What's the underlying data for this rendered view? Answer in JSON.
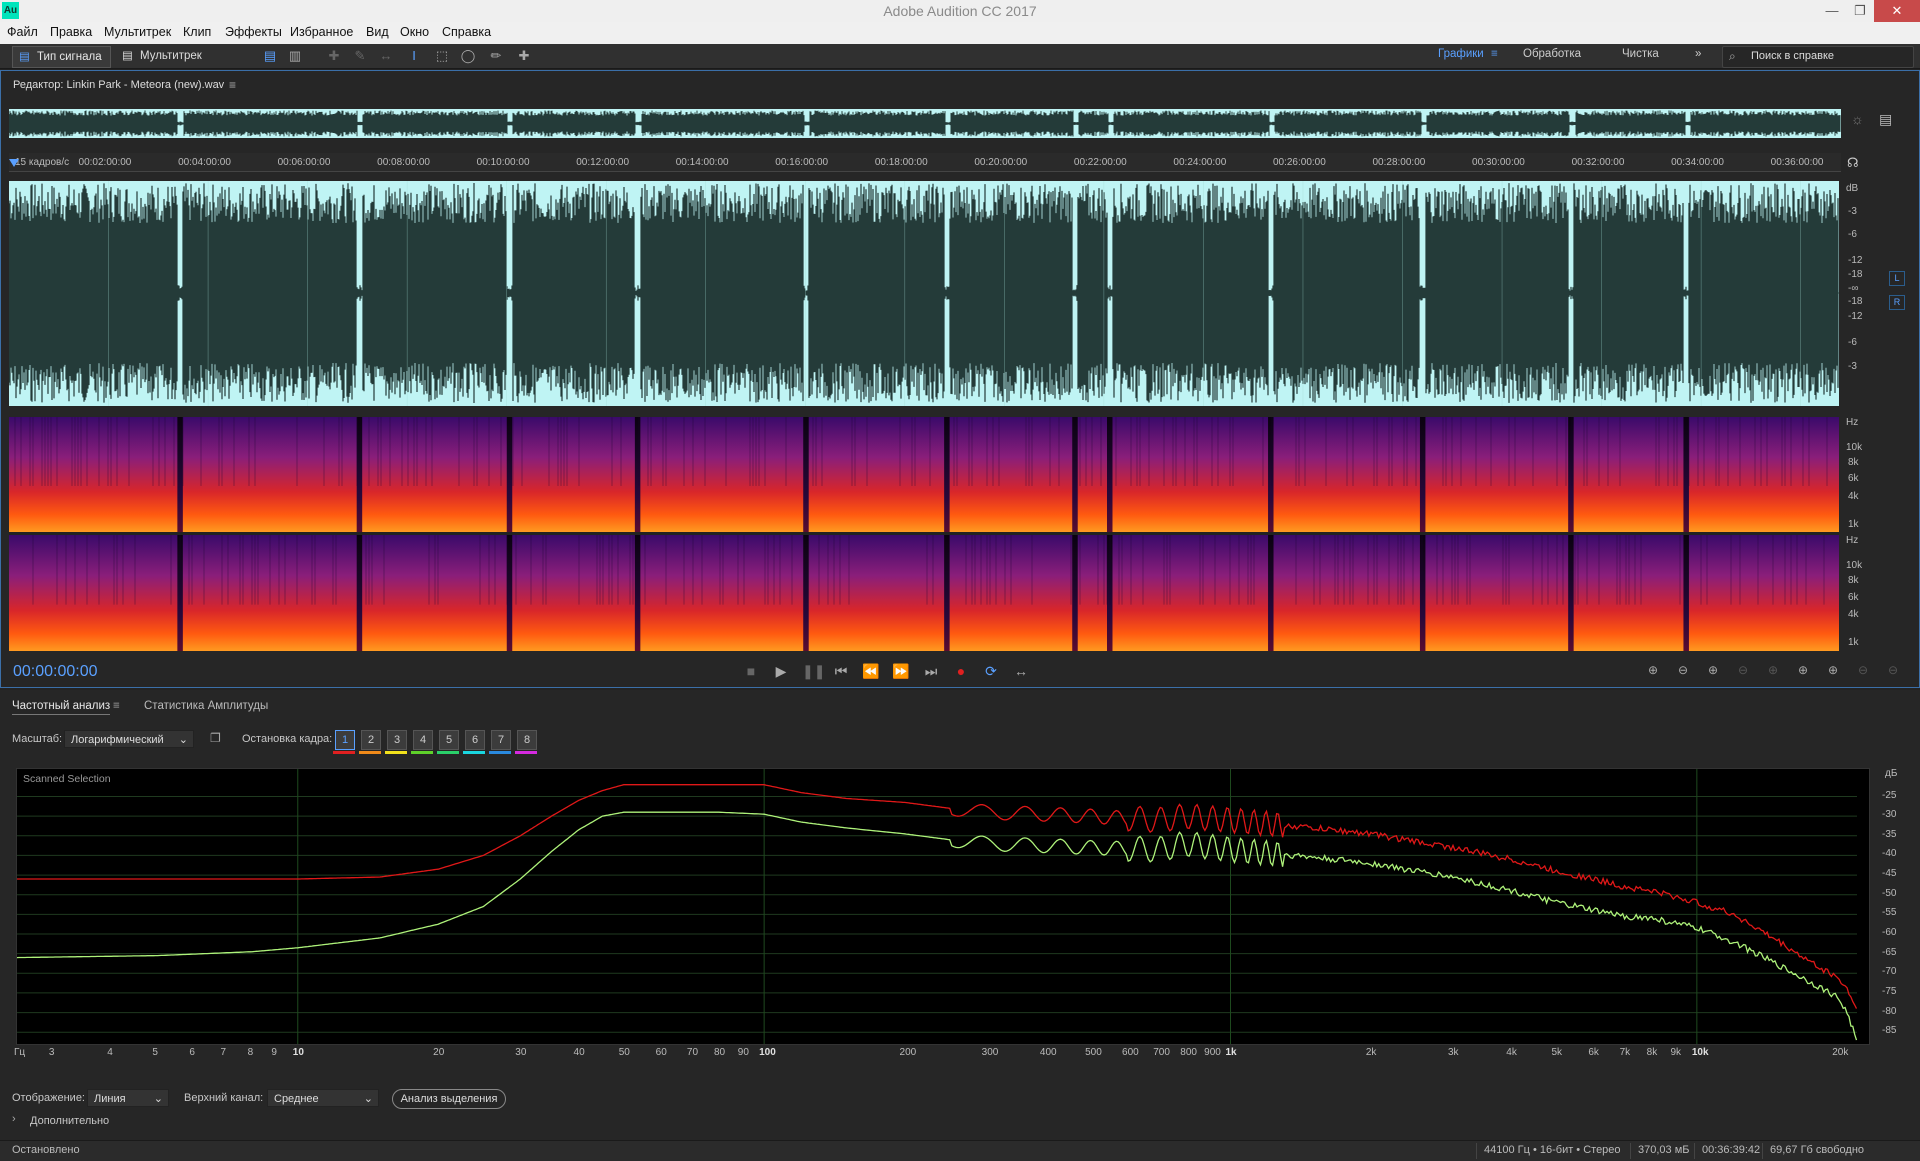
{
  "window": {
    "title": "Adobe Audition CC 2017",
    "app_icon": "Au"
  },
  "menu": [
    "Файл",
    "Правка",
    "Мультитрек",
    "Клип",
    "Эффекты",
    "Избранное",
    "Вид",
    "Окно",
    "Справка"
  ],
  "toolbar": {
    "mode_waveform": "Тип сигнала",
    "mode_multitrack": "Мультитрек",
    "workspaces": [
      "Графики",
      "Обработка",
      "Чистка"
    ],
    "search_placeholder": "Поиск в справке"
  },
  "editor": {
    "title": "Редактор: Linkin Park - Meteora (new).wav",
    "ruler_unit": "15 кадров/с",
    "ruler_ticks": [
      "00:02:00:00",
      "00:04:00:00",
      "00:06:00:00",
      "00:08:00:00",
      "00:10:00:00",
      "00:12:00:00",
      "00:14:00:00",
      "00:16:00:00",
      "00:18:00:00",
      "00:20:00:00",
      "00:22:00:00",
      "00:24:00:00",
      "00:26:00:00",
      "00:28:00:00",
      "00:30:00:00",
      "00:32:00:00",
      "00:34:00:00",
      "00:36:00:00"
    ],
    "db_label": "dB",
    "db_scale_top": [
      "-3",
      "-6",
      "-12",
      "-18"
    ],
    "db_center": "-∞",
    "db_scale_bottom": [
      "-18",
      "-12",
      "-6",
      "-3"
    ],
    "channel_left": "L",
    "channel_right": "R",
    "hz_label": "Hz",
    "hz_scale": [
      "10k",
      "8k",
      "6k",
      "4k",
      "1k"
    ],
    "timecode": "00:00:00:00",
    "track_segments": [
      [
        0,
        0.092
      ],
      [
        0.095,
        0.19
      ],
      [
        0.193,
        0.272
      ],
      [
        0.275,
        0.342
      ],
      [
        0.345,
        0.434
      ],
      [
        0.437,
        0.511
      ],
      [
        0.514,
        0.581
      ],
      [
        0.584,
        0.6
      ],
      [
        0.603,
        0.688
      ],
      [
        0.691,
        0.771
      ],
      [
        0.774,
        0.852
      ],
      [
        0.855,
        0.915
      ],
      [
        0.918,
        1.0
      ]
    ],
    "zoom_icons": [
      "zoom-in-amplitude-icon",
      "zoom-out-amplitude-icon",
      "zoom-in-time-icon",
      "zoom-out-full-icon",
      "zoom-selection-icon",
      "zoom-in-left-icon",
      "zoom-in-right-icon",
      "zoom-left-icon",
      "zoom-right-icon"
    ]
  },
  "analysis": {
    "tab_active": "Частотный анализ",
    "tab_inactive": "Статистика Амплитуды",
    "scale_label": "Масштаб:",
    "scale_value": "Логарифмический",
    "freeze_label": "Остановка кадра:",
    "frames": [
      "1",
      "2",
      "3",
      "4",
      "5",
      "6",
      "7",
      "8"
    ],
    "frame_colors": [
      "#e02020",
      "#f08a1a",
      "#f2e11c",
      "#5fd12a",
      "#2ad06a",
      "#1ad6e0",
      "#2a8ae0",
      "#d52ae0"
    ],
    "graph_title": "Scanned Selection",
    "db_unit": "дБ",
    "x_unit": "Гц",
    "display_label": "Отображение:",
    "display_value": "Линия",
    "channel_label": "Верхний канал:",
    "channel_value": "Среднее",
    "analyze_button": "Анализ выделения",
    "advanced": "Дополнительно"
  },
  "chart_data": {
    "type": "line",
    "title": "Scanned Selection",
    "xlabel": "Гц",
    "ylabel": "дБ",
    "x_scale": "log",
    "xlim": [
      2.5,
      22050
    ],
    "ylim": [
      -88,
      -18
    ],
    "x_tick_labels": [
      "3",
      "4",
      "5",
      "6",
      "7",
      "8",
      "9",
      "10",
      "20",
      "30",
      "40",
      "50",
      "60",
      "70",
      "80",
      "90",
      "100",
      "200",
      "300",
      "400",
      "500",
      "600",
      "700",
      "800",
      "900",
      "1k",
      "2k",
      "3k",
      "4k",
      "5k",
      "6k",
      "7k",
      "8k",
      "9k",
      "10k",
      "20k"
    ],
    "x_tick_values": [
      3,
      4,
      5,
      6,
      7,
      8,
      9,
      10,
      20,
      30,
      40,
      50,
      60,
      70,
      80,
      90,
      100,
      200,
      300,
      400,
      500,
      600,
      700,
      800,
      900,
      1000,
      2000,
      3000,
      4000,
      5000,
      6000,
      7000,
      8000,
      9000,
      10000,
      20000
    ],
    "y_ticks": [
      -25,
      -30,
      -35,
      -40,
      -45,
      -50,
      -55,
      -60,
      -65,
      -70,
      -75,
      -80,
      -85
    ],
    "grid": true,
    "series": [
      {
        "color": "#e01818",
        "x": [
          2.5,
          5,
          10,
          15,
          20,
          25,
          30,
          35,
          40,
          45,
          50,
          60,
          80,
          100,
          120,
          150,
          200,
          250,
          300,
          400,
          500,
          700,
          800,
          1000,
          1500,
          2000,
          2500,
          3000,
          4000,
          5000,
          6000,
          7000,
          8000,
          10000,
          12000,
          15000,
          18000,
          20000,
          21000,
          22000
        ],
        "y": [
          -46,
          -46,
          -46,
          -45.5,
          -43.5,
          -40,
          -35,
          -30,
          -26,
          -23.5,
          -22,
          -22,
          -22,
          -22,
          -24,
          -25.5,
          -26.5,
          -28,
          -29,
          -29.5,
          -30,
          -31,
          -30,
          -31,
          -33,
          -34.5,
          -36.5,
          -38,
          -41,
          -44,
          -46,
          -48,
          -49,
          -52,
          -55,
          -62,
          -68,
          -71,
          -74,
          -79
        ]
      },
      {
        "color": "#aef27a",
        "x": [
          2.5,
          5,
          8,
          10,
          15,
          20,
          25,
          30,
          35,
          40,
          45,
          50,
          60,
          80,
          100,
          120,
          150,
          200,
          250,
          300,
          400,
          500,
          700,
          800,
          1000,
          1500,
          2000,
          2500,
          3000,
          4000,
          5000,
          6000,
          7000,
          8000,
          10000,
          12000,
          15000,
          18000,
          20000,
          21000,
          22000
        ],
        "y": [
          -66,
          -65.5,
          -64.5,
          -63.5,
          -61,
          -57.5,
          -53,
          -46,
          -39,
          -33.5,
          -30,
          -29,
          -29,
          -29,
          -29.5,
          -31.5,
          -33,
          -34.5,
          -36,
          -37,
          -37.5,
          -38,
          -38.5,
          -37,
          -38.5,
          -40.5,
          -42,
          -44,
          -45.5,
          -49,
          -52,
          -54,
          -55.5,
          -56,
          -58.5,
          -62,
          -68,
          -73,
          -76,
          -80,
          -87
        ]
      }
    ]
  },
  "status": {
    "state": "Остановлено",
    "format": "44100 Гц • 16-бит • Стерео",
    "size": "370,03 мБ",
    "duration": "00:36:39:42",
    "free": "69,67 Гб свободно"
  }
}
